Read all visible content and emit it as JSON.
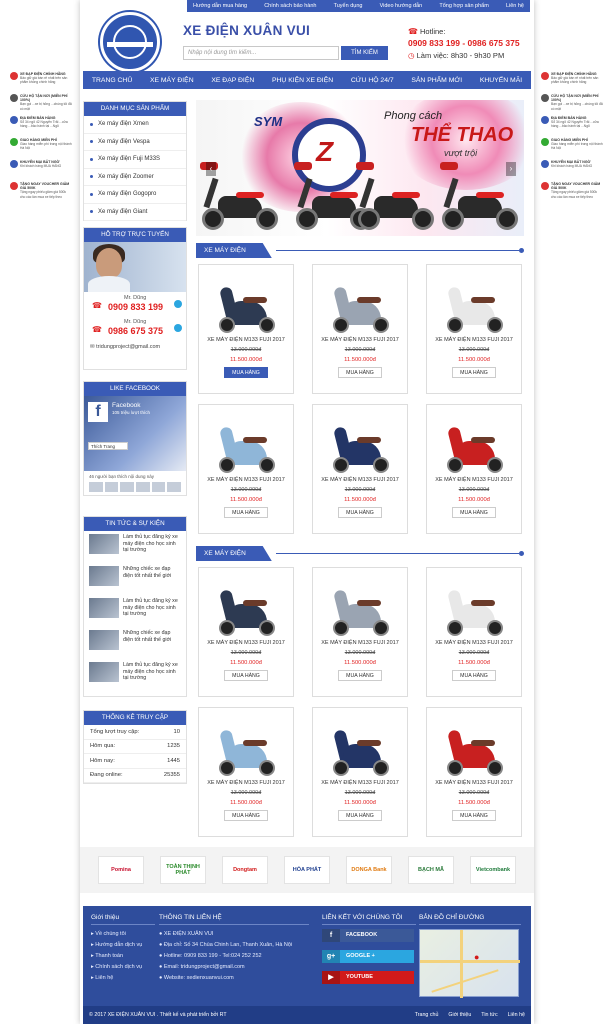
{
  "topbar": [
    "Hướng dẫn mua hàng",
    "Chính sách bảo hành",
    "Tuyển dụng",
    "Video hướng dẫn",
    "Tổng hợp sản phẩm",
    "Liên hệ"
  ],
  "header": {
    "brand": "XE ĐIỆN XUÂN VUI",
    "search_placeholder": "Nhập nội dung tìm kiếm...",
    "search_btn": "TÌM KIẾM",
    "hotline_label": "Hotline:",
    "hotline_numbers": "0909 833 199 - 0986 675 375",
    "hours": "Làm việc: 8h30 - 9h30 PM"
  },
  "nav": [
    "TRANG CHỦ",
    "XE MÁY ĐIỆN",
    "XE ĐẠP ĐIỆN",
    "PHỤ KIỆN XE ĐIỆN",
    "CỨU HỘ 24/7",
    "SẢN PHẨM MỚI",
    "KHUYẾN MÃI"
  ],
  "sidead": [
    {
      "title": "XE ĐẠP ĐIỆN CHÍNH HÃNG",
      "text": "Bảo giữ giá bán rẻ nhất trên sản phẩm không chính hãng",
      "color": "#d33"
    },
    {
      "title": "CỨU HỘ TẬN NƠI (MIỄN PHÍ 100%)",
      "text": "Bạn gọi ...xe bị hỏng ...chúng tôi đã có mặt",
      "color": "#555"
    },
    {
      "title": "ĐỊA ĐIỂM BÁN HÀNG",
      "text": "Sổ 34 ngõ 42 Nguyễn Trãi ...cửa hàng ...bảo hành tại ...Ngõ",
      "color": "#3a5bb6"
    },
    {
      "title": "GIAO HÀNG MIỄN PHÍ",
      "text": "Giao hàng miễn phí trong nội thành Hà Nội",
      "color": "#3a3"
    },
    {
      "title": "KHUYẾN MẠI BẤT NGỜ",
      "text": "Khi khách hàng MUA HÀNG",
      "color": "#3a5bb6"
    },
    {
      "title": "TẶNG NGAY VOUCHER GIẢM GIÁ 500K",
      "text": "Tặng ngay phiếu giảm giá 500k cho các lần mua xe tiếp theo",
      "color": "#d33"
    }
  ],
  "sidead_right": [
    {
      "title": "XE ĐẠP ĐIỆN CHÍNH HÃNG",
      "text": "Bảo giữ giá bán rẻ nhất trên sản phẩm không chính hãng",
      "color": "#d33"
    },
    {
      "title": "CỨU HỘ TẬN NƠI (MIỄN PHÍ 100%)",
      "text": "Bạn gọi ...xe bị hỏng ...chúng tôi đã có mặt",
      "color": "#555"
    },
    {
      "title": "ĐỊA ĐIỂM BÁN HÀNG",
      "text": "Sổ 34 ngõ 42 Nguyễn Trãi ...cửa hàng ...bảo hành tại ...Ngõ",
      "color": "#3a5bb6"
    },
    {
      "title": "GIAO HÀNG MIỄN PHÍ",
      "text": "Giao hàng miễn phí trong nội thành Hà Nội",
      "color": "#3a3"
    },
    {
      "title": "KHUYẾN MẠI BẤT NGỜ",
      "text": "Khi khách hàng MUA HÀNG",
      "color": "#3a5bb6"
    },
    {
      "title": "TẶNG NGAY VOUCHER GIẢM GIÁ 500K",
      "text": "Tặng ngay phiếu giảm giá 500k cho các lần mua xe tiếp theo",
      "color": "#d33"
    }
  ],
  "categories": {
    "title": "DANH MỤC SẢN PHẨM",
    "items": [
      "Xe máy điện Xmen",
      "Xe máy điện Vespa",
      "Xe máy điện Fuji M33S",
      "Xe máy điện Zoomer",
      "Xe máy điện Gogopro",
      "Xe máy điện Giant"
    ]
  },
  "support": {
    "title": "HỖ TRỢ TRỰC TUYẾN",
    "contacts": [
      {
        "name": "Mr. Dũng",
        "phone": "0909 833 199"
      },
      {
        "name": "Mr. Dũng",
        "phone": "0986 675 375"
      }
    ],
    "email": "tridungproject@gmail.com"
  },
  "facebook": {
    "title": "LIKE FACEBOOK",
    "page": "Facebook",
    "likes": "105 triệu lượt thích",
    "like_btn": "Thích Trang",
    "friends": "46 người bạn thích nội dung này"
  },
  "news": {
    "title": "TIN TỨC & SỰ KIỆN",
    "items": [
      "Làm thủ tục đăng ký xe máy điện cho học sinh tại trường",
      "Những chiếc xe đạp điện tốt nhất thế giới",
      "Làm thủ tục đăng ký xe máy điện cho học sinh tại trường",
      "Những chiếc xe đạp điện tốt nhất thế giới",
      "Làm thủ tục đăng ký xe máy điện cho học sinh tại trường"
    ]
  },
  "stats": {
    "title": "THỐNG KÊ TRUY CẬP",
    "rows": [
      {
        "label": "Tổng lượt truy cập:",
        "value": "10"
      },
      {
        "label": "Hôm qua:",
        "value": "1235"
      },
      {
        "label": "Hôm nay:",
        "value": "1445"
      },
      {
        "label": "Đang online:",
        "value": "25355"
      }
    ]
  },
  "banner": {
    "brand": "SYM",
    "model": "Z",
    "slogan1": "Phong cách",
    "slogan2": "THỂ THAO",
    "slogan3": "vượt trội"
  },
  "sections": [
    {
      "title": "XE MÁY ĐIỆN",
      "products": [
        {
          "name": "XE MÁY ĐIỆN M133 FUJI 2017",
          "old": "13.000.000đ",
          "new": "11.500.000đ",
          "btn": "MUA HÀNG",
          "color": "#2d3a52",
          "active": true
        },
        {
          "name": "XE MÁY ĐIỆN M133 FUJI 2017",
          "old": "13.000.000đ",
          "new": "11.500.000đ",
          "btn": "MUA HÀNG",
          "color": "#9aa4b2",
          "active": false
        },
        {
          "name": "XE MÁY ĐIỆN M133 FUJI 2017",
          "old": "13.000.000đ",
          "new": "11.500.000đ",
          "btn": "MUA HÀNG",
          "color": "#e8e8e8",
          "active": false
        },
        {
          "name": "XE MÁY ĐIỆN M133 FUJI 2017",
          "old": "13.000.000đ",
          "new": "11.500.000đ",
          "btn": "MUA HÀNG",
          "color": "#8fb6d8",
          "active": false
        },
        {
          "name": "XE MÁY ĐIỆN M133 FUJI 2017",
          "old": "13.000.000đ",
          "new": "11.500.000đ",
          "btn": "MUA HÀNG",
          "color": "#233566",
          "active": false
        },
        {
          "name": "XE MÁY ĐIỆN M133 FUJI 2017",
          "old": "13.000.000đ",
          "new": "11.500.000đ",
          "btn": "MUA HÀNG",
          "color": "#c82020",
          "active": false
        }
      ]
    },
    {
      "title": "XE MÁY ĐIỆN",
      "products": [
        {
          "name": "XE MÁY ĐIỆN M133 FUJI 2017",
          "old": "13.000.000đ",
          "new": "11.500.000đ",
          "btn": "MUA HÀNG",
          "color": "#2d3a52",
          "active": false
        },
        {
          "name": "XE MÁY ĐIỆN M133 FUJI 2017",
          "old": "13.000.000đ",
          "new": "11.500.000đ",
          "btn": "MUA HÀNG",
          "color": "#9aa4b2",
          "active": false
        },
        {
          "name": "XE MÁY ĐIỆN M133 FUJI 2017",
          "old": "13.000.000đ",
          "new": "11.500.000đ",
          "btn": "MUA HÀNG",
          "color": "#e8e8e8",
          "active": false
        },
        {
          "name": "XE MÁY ĐIỆN M133 FUJI 2017",
          "old": "13.000.000đ",
          "new": "11.500.000đ",
          "btn": "MUA HÀNG",
          "color": "#8fb6d8",
          "active": false
        },
        {
          "name": "XE MÁY ĐIỆN M133 FUJI 2017",
          "old": "13.000.000đ",
          "new": "11.500.000đ",
          "btn": "MUA HÀNG",
          "color": "#233566",
          "active": false
        },
        {
          "name": "XE MÁY ĐIỆN M133 FUJI 2017",
          "old": "13.000.000đ",
          "new": "11.500.000đ",
          "btn": "MUA HÀNG",
          "color": "#c82020",
          "active": false
        }
      ]
    }
  ],
  "partners": [
    {
      "name": "Pomina",
      "color": "#c8102e"
    },
    {
      "name": "TOÀN THỊNH PHÁT",
      "color": "#2a8a2a"
    },
    {
      "name": "Dongtam",
      "color": "#d21a1a"
    },
    {
      "name": "HÒA PHÁT",
      "color": "#1f3f8f"
    },
    {
      "name": "DONGA Bank",
      "color": "#e07a10"
    },
    {
      "name": "BẠCH MÃ",
      "color": "#2a7a3a"
    },
    {
      "name": "Vietcombank",
      "color": "#1e7a3a"
    }
  ],
  "footer": {
    "col1": {
      "title": "Giới thiệu",
      "items": [
        "Về chúng tôi",
        "Hướng dẫn dịch vụ",
        "Thanh toán",
        "Chính sách dịch vụ",
        "Liên hệ"
      ]
    },
    "col2": {
      "title": "THÔNG TIN LIÊN HỆ",
      "items": [
        "XE ĐIỆN XUÂN VUI",
        "Địa chỉ: Số 34 Chùa Chinh Lan, Thanh Xuân, Hà Nội",
        "Hotline: 0909 833 199 - Tel:024 252 252",
        "Email: tridungproject@gmail.com",
        "Website: xedienxuanvui.com"
      ]
    },
    "col3": {
      "title": "LIÊN KẾT VỚI CHÚNG TÔI",
      "social": [
        {
          "label": "FACEBOOK",
          "color": "#3b5998",
          "icon": "f"
        },
        {
          "label": "GOOGLE +",
          "color": "#2ba6e0",
          "icon": "g+"
        },
        {
          "label": "YOUTUBE",
          "color": "#d21a1a",
          "icon": "▶"
        }
      ]
    },
    "col4": {
      "title": "BẢN ĐỒ CHỈ ĐƯỜNG"
    },
    "copyright": "© 2017 XE ĐIỆN XUÂN VUI . Thiết kế và phát triển bởi RT",
    "links": [
      "Trang chủ",
      "Giới thiệu",
      "Tin tức",
      "Liên hệ"
    ]
  }
}
